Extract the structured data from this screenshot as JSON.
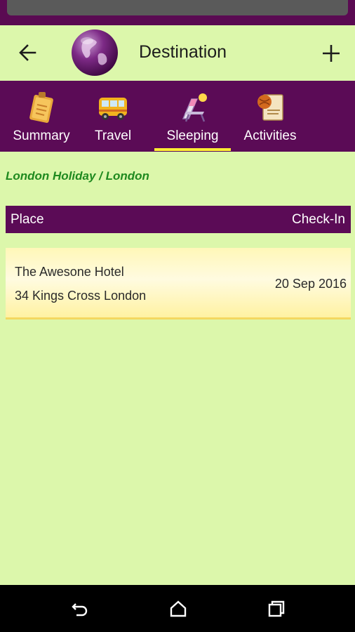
{
  "app_bar": {
    "title": "Destination",
    "back_icon": "arrow-left-icon",
    "logo_icon": "globe-icon",
    "add_icon": "plus-icon"
  },
  "tabs": [
    {
      "label": "Summary",
      "icon": "notebook-icon",
      "selected": false
    },
    {
      "label": "Travel",
      "icon": "bus-icon",
      "selected": false
    },
    {
      "label": "Sleeping",
      "icon": "deck-chair-icon",
      "selected": true
    },
    {
      "label": "Activities",
      "icon": "golf-icon",
      "selected": false
    }
  ],
  "breadcrumb": "London Holiday / London",
  "table": {
    "headers": {
      "place": "Place",
      "checkin": "Check-In"
    },
    "rows": [
      {
        "name": "The Awesone Hotel",
        "address": "34 Kings Cross London",
        "checkin": "20 Sep 2016"
      }
    ]
  },
  "colors": {
    "background": "#dcf7ab",
    "accent": "#5b0b56",
    "indicator": "#ffee33",
    "breadcrumb": "#1f8a1f"
  },
  "nav": {
    "back_icon": "nav-back-icon",
    "home_icon": "nav-home-icon",
    "recents_icon": "nav-recents-icon"
  }
}
